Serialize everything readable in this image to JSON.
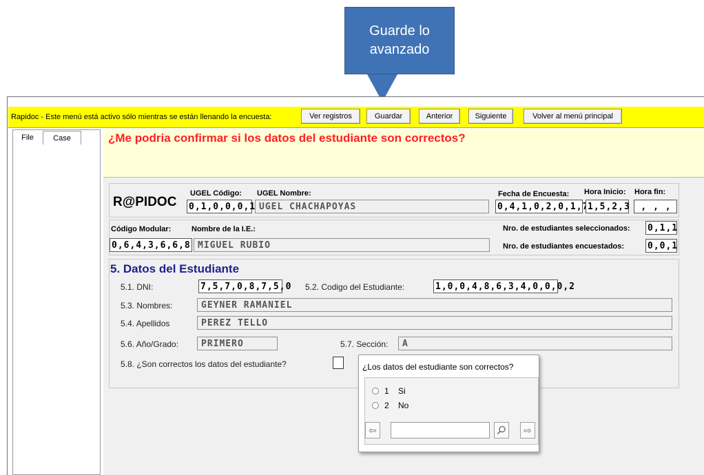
{
  "callout": {
    "text_line1": "Guarde lo",
    "text_line2": "avanzado",
    "color": "#3f73b5"
  },
  "toolbar": {
    "message": "Rapidoc - Este menú está activo sólo mientras se están llenando la encuesta:",
    "buttons": [
      "Ver registros",
      "Guardar",
      "Anterior",
      "Siguiente",
      "Volver al menú principal"
    ],
    "background": "#ffff00"
  },
  "left_pane": {
    "tabs": [
      "File",
      "Case"
    ]
  },
  "question": {
    "text": "¿Me podria confirmar si los datos del estudiante son correctos?",
    "color": "#ff2020"
  },
  "header": {
    "brand": "R@PIDOC",
    "ugel_codigo_label": "UGEL Código:",
    "ugel_codigo_value": "0,1,0,0,0,1",
    "ugel_nombre_label": "UGEL Nombre:",
    "ugel_nombre_value": "UGEL CHACHAPOYAS",
    "fecha_label": "Fecha de Encuesta:",
    "fecha_value": "0,4,1,0,2,0,1,7",
    "hora_inicio_label": "Hora Inicio:",
    "hora_inicio_value": "1,5,2,3",
    "hora_fin_label": "Hora fin:",
    "hora_fin_value": ", , ,",
    "codigo_modular_label": "Código Modular:",
    "codigo_modular_value": "0,6,4,3,6,6,8",
    "nombre_ie_label": "Nombre de la I.E.:",
    "nombre_ie_value": "MIGUEL RUBIO",
    "seleccionados_label": "Nro. de estudiantes seleccionados:",
    "seleccionados_value": "0,1,1",
    "encuestados_label": "Nro. de estudiantes encuestados:",
    "encuestados_value": "0,0,1"
  },
  "section": {
    "title": "5. Datos del Estudiante",
    "dni_label": "5.1. DNI:",
    "dni_value": "7,5,7,0,8,7,5,0",
    "codigo_label": "5.2. Codigo del Estudiante:",
    "codigo_value": "1,0,0,4,8,6,3,4,0,0,0,2",
    "nombres_label": "5.3. Nombres:",
    "nombres_value": "GEYNER RAMANIEL",
    "apellidos_label": "5.4. Apellidos",
    "apellidos_value": "PEREZ TELLO",
    "grado_label": "5.6. Año/Grado:",
    "grado_value": "PRIMERO",
    "seccion_label": "5.7. Sección:",
    "seccion_value": "A",
    "correctos_label": "5.8. ¿Son correctos los datos del estudiante?"
  },
  "popup": {
    "question": "¿Los datos del estudiante son correctos?",
    "options": [
      {
        "code": "1",
        "label": "Si"
      },
      {
        "code": "2",
        "label": "No"
      }
    ],
    "prev_icon": "arrow-left-icon",
    "search_icon": "search-icon",
    "next_icon": "arrow-right-icon"
  }
}
